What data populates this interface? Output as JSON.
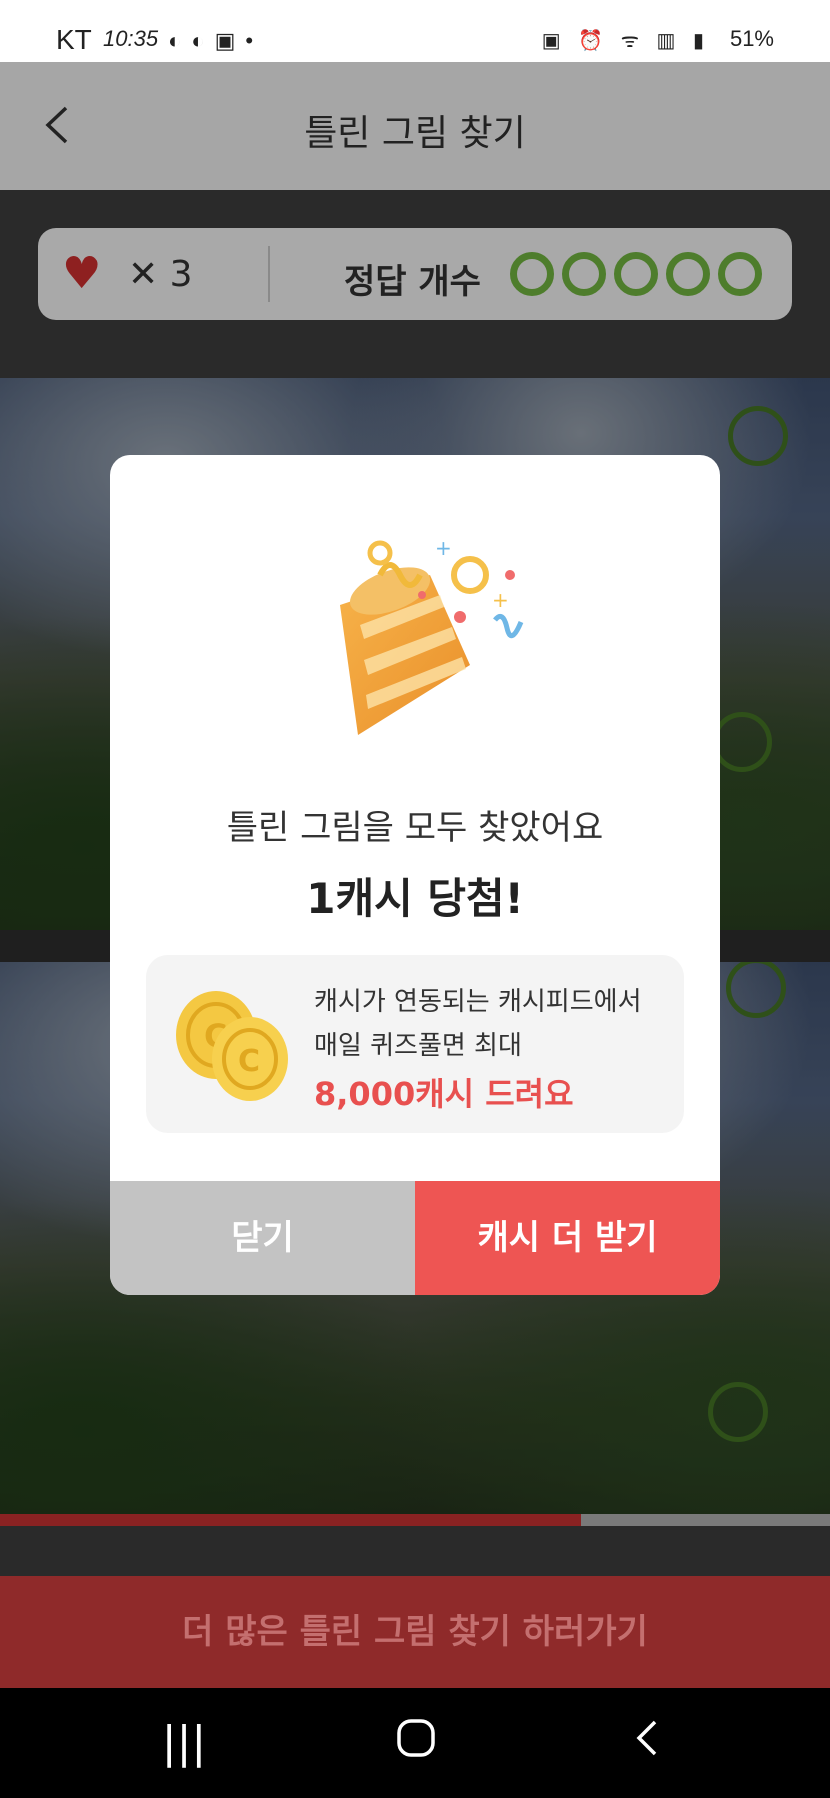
{
  "status_bar": {
    "carrier": "KT",
    "time": "10:35",
    "battery": "51%"
  },
  "header": {
    "title": "틀린 그림 찾기",
    "back_icon": "chevron-left-icon"
  },
  "score": {
    "lives": "✕ 3",
    "answer_label": "정답 개수",
    "answers_total": 5,
    "answers_found": 0
  },
  "modal": {
    "message": "틀린 그림을 모두 찾았어요",
    "prize": "1캐시 당첨!",
    "promo": {
      "line1": "캐시가 연동되는 캐시피드에서",
      "line2": "매일 퀴즈풀면 최대",
      "line3": "8,000캐시 드려요"
    },
    "close_label": "닫기",
    "more_label": "캐시 더 받기"
  },
  "progress": {
    "value": 0.7
  },
  "cta_label": "더 많은 틀린 그림 찾기 하러가기",
  "colors": {
    "accent": "#ee5553",
    "circle_green": "#4e7d2c",
    "promo_red": "#e8504f"
  }
}
